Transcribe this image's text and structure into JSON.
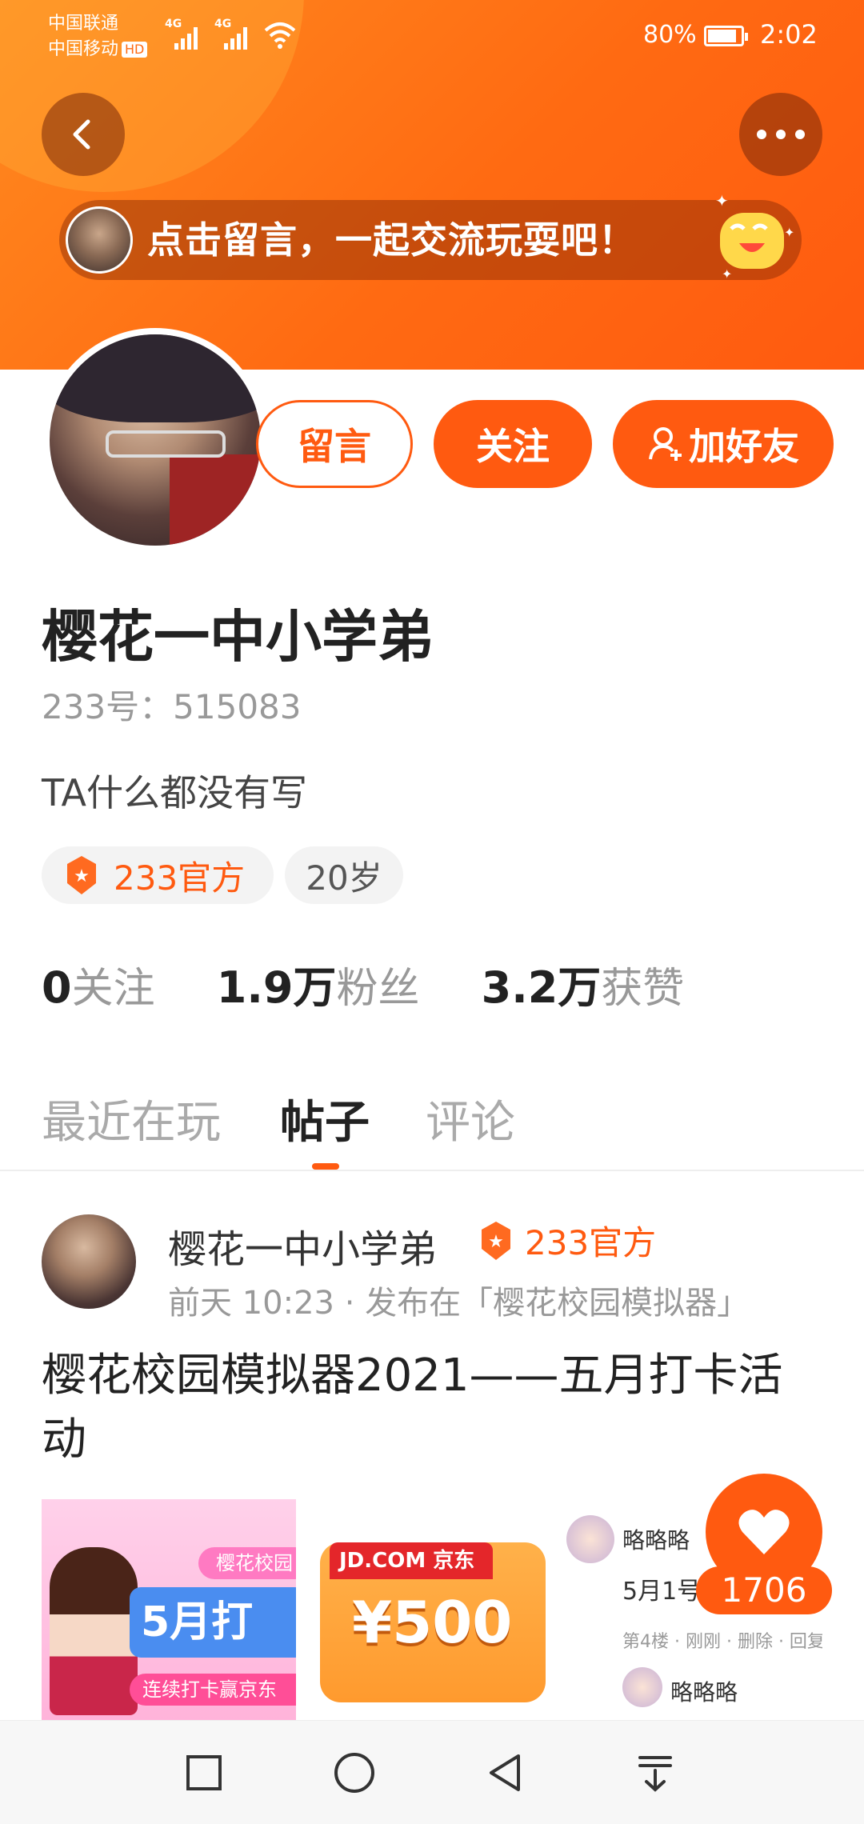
{
  "status_bar": {
    "carrier_1": "中国联通",
    "carrier_2": "中国移动",
    "hd_label": "HD",
    "network_1": "4G",
    "network_2": "4G",
    "battery_percent": "80%",
    "battery_level": 0.8,
    "time": "2:02"
  },
  "header": {
    "message_prompt": "点击留言，一起交流玩耍吧！",
    "back_icon": "chevron-left-icon",
    "more_icon": "more-dots-icon"
  },
  "profile": {
    "message_button": "留言",
    "follow_button": "关注",
    "add_friend_button": "加好友",
    "username": "樱花一中小学弟",
    "user_id": "233号：515083",
    "bio": "TA什么都没有写",
    "tags": {
      "official": "233官方",
      "age": "20岁"
    },
    "stats": {
      "following_value": "0",
      "following_label": "关注",
      "fans_value": "1.9万",
      "fans_label": "粉丝",
      "likes_value": "3.2万",
      "likes_label": "获赞"
    }
  },
  "tabs": {
    "recent": "最近在玩",
    "posts": "帖子",
    "comments": "评论",
    "active": "帖子"
  },
  "post": {
    "author": "樱花一中小学弟",
    "badge": "233官方",
    "meta": "前天 10:23 · 发布在「樱花校园模拟器」",
    "title": "樱花校园模拟器2021——五月打卡活动",
    "thumb1": {
      "ribbon": "樱花校园",
      "headline": "5月打",
      "subline": "连续打卡赢京东"
    },
    "thumb2": {
      "brand": "JD.COM 京东",
      "amount": "¥500"
    },
    "thumb3": {
      "name_1": "略略略",
      "line_1": "5月1号",
      "info": "第4楼 · 刚刚 · 删除 · 回复",
      "name_2": "略略略"
    }
  },
  "like": {
    "count": "1706"
  },
  "colors": {
    "accent": "#ff5a10",
    "banner_start": "#ff8a1f",
    "text_primary": "#222222",
    "text_secondary": "#999999"
  }
}
